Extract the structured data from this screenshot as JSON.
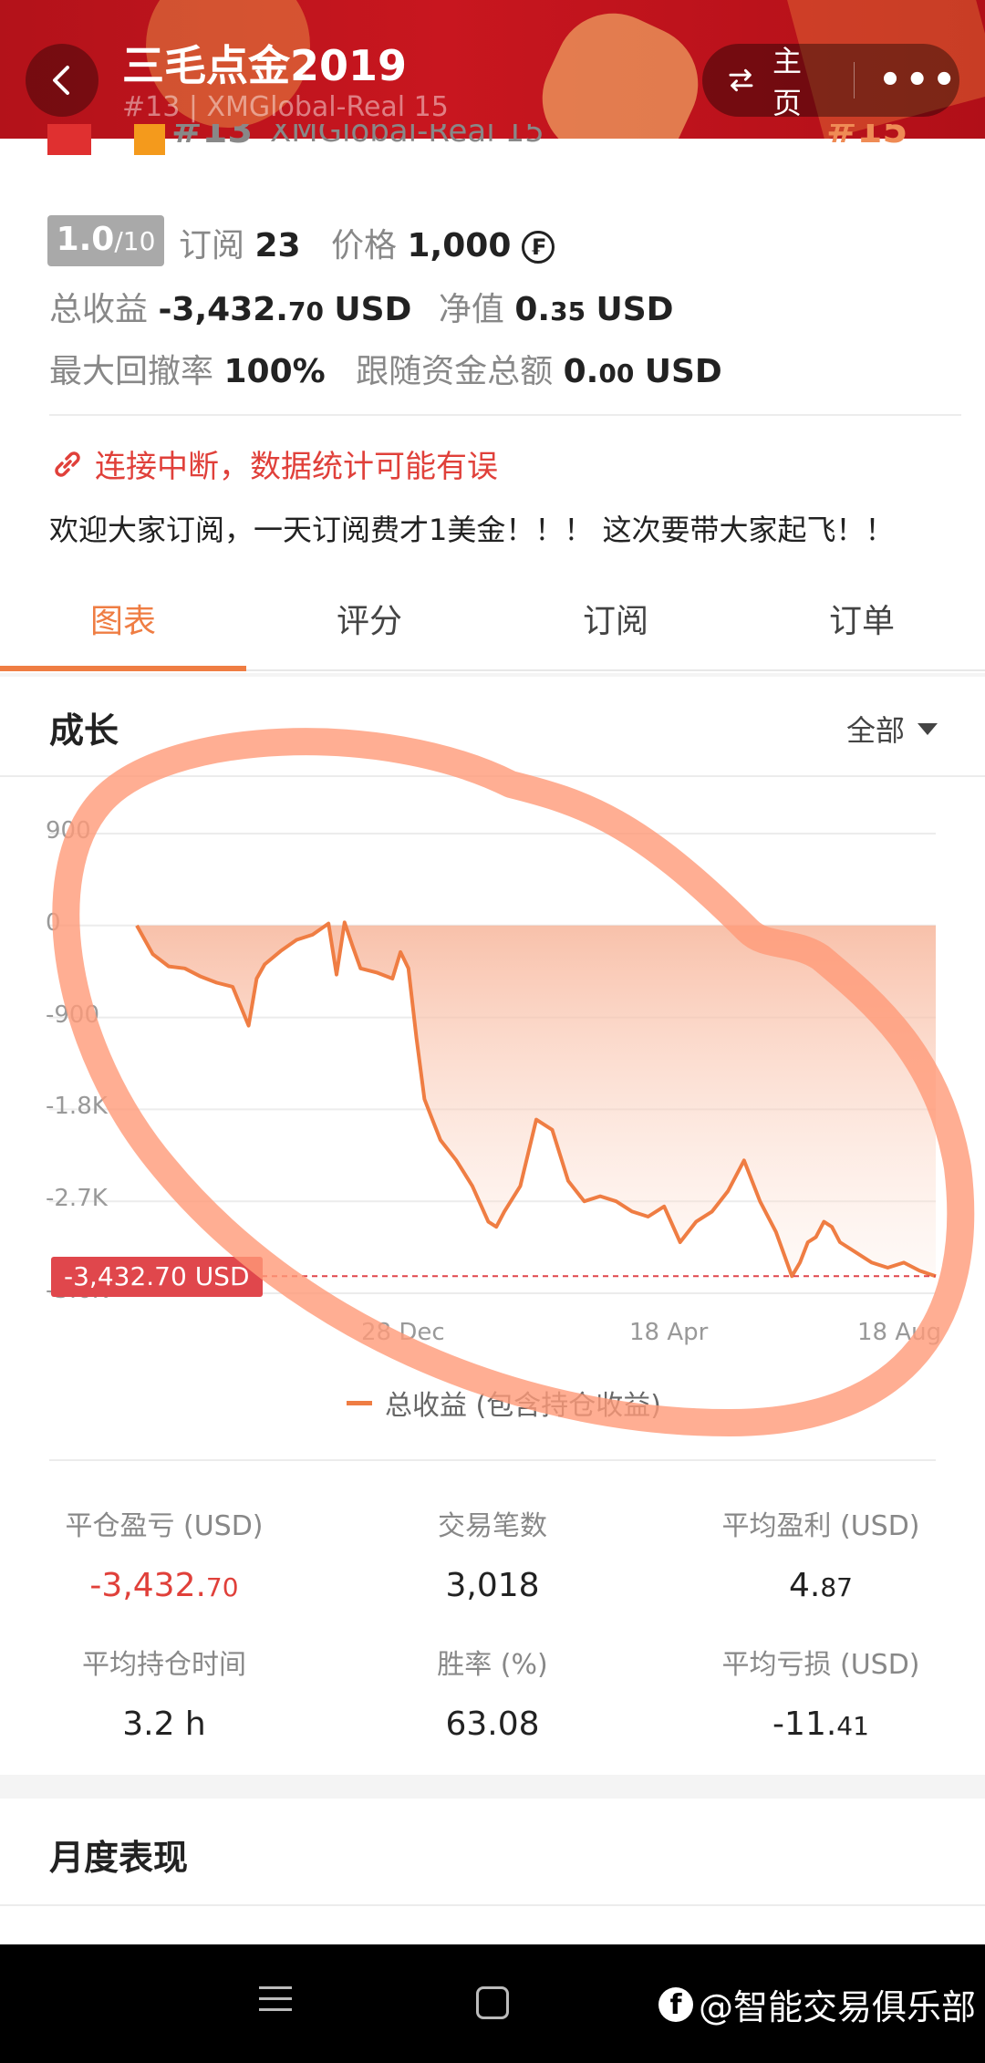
{
  "header": {
    "title": "三毛点金2019",
    "subtitle": "#13 | XMGlobal-Real 15",
    "home_label": "主页",
    "more_label": "•••"
  },
  "strip": {
    "rank": "#13",
    "account": "XMGlobal-Real 15",
    "rank_right": "#15"
  },
  "stats": {
    "score_main": "1.0",
    "score_max": "/10",
    "subscribe_label": "订阅",
    "subscribe_value": "23",
    "price_label": "价格",
    "price_value": "1,000",
    "price_icon": "₣",
    "total_profit_label": "总收益",
    "total_profit_main": "-3,432.",
    "total_profit_dec": "70",
    "total_profit_unit": "USD",
    "nav_label": "净值",
    "nav_main": "0.",
    "nav_dec": "35",
    "nav_unit": "USD",
    "drawdown_label": "最大回撤率",
    "drawdown_value": "100%",
    "follow_label": "跟随资金总额",
    "follow_main": "0.",
    "follow_dec": "00",
    "follow_unit": "USD"
  },
  "warning": "连接中断，数据统计可能有误",
  "description": "欢迎大家订阅，一天订阅费才1美金！！！ 这次要带大家起飞！！",
  "tabs": [
    "图表",
    "评分",
    "订阅",
    "订单"
  ],
  "growth": {
    "title": "成长",
    "filter": "全部"
  },
  "chart_data": {
    "type": "area",
    "title": "成长",
    "y_ticks": [
      "900",
      "0",
      "-900",
      "-1.8K",
      "-2.7K",
      "-3.6K"
    ],
    "x_ticks": [
      "28 Dec",
      "18 Apr",
      "18 Aug"
    ],
    "ylim": [
      -3600,
      900
    ],
    "series": [
      {
        "name": "总收益 (包含持仓收益)",
        "color": "#ef7d43",
        "x": [
          0,
          2,
          4,
          6,
          8,
          10,
          12,
          14,
          15,
          16,
          18,
          20,
          22,
          24,
          25,
          26,
          27,
          28,
          30,
          32,
          33,
          34,
          35,
          36,
          37,
          38,
          40,
          42,
          44,
          45,
          46,
          48,
          50,
          52,
          54,
          56,
          58,
          60,
          62,
          64,
          66,
          68,
          70,
          72,
          74,
          76,
          78,
          80,
          82,
          83,
          84,
          85,
          86,
          87,
          88,
          90,
          92,
          94,
          96,
          98,
          100
        ],
        "values": [
          0,
          -280,
          -400,
          -420,
          -500,
          -560,
          -600,
          -980,
          -520,
          -380,
          -250,
          -140,
          -90,
          20,
          -480,
          30,
          -200,
          -420,
          -460,
          -520,
          -260,
          -420,
          -1100,
          -1700,
          -1900,
          -2100,
          -2300,
          -2550,
          -2900,
          -2950,
          -2800,
          -2550,
          -1900,
          -2000,
          -2500,
          -2700,
          -2650,
          -2700,
          -2800,
          -2850,
          -2750,
          -3100,
          -2900,
          -2800,
          -2600,
          -2300,
          -2700,
          -3000,
          -3432.7,
          -3300,
          -3100,
          -3050,
          -2900,
          -2950,
          -3100,
          -3200,
          -3300,
          -3350,
          -3300,
          -3380,
          -3432.7
        ]
      }
    ],
    "current_value_label": "-3,432.70 USD",
    "legend": "总收益 (包含持仓收益)",
    "grid": true,
    "legend_position": "bottom-center"
  },
  "summary": [
    {
      "label": "平仓盈亏 (USD)",
      "main": "-3,432.",
      "dec": "70",
      "red": true
    },
    {
      "label": "交易笔数",
      "main": "3,018",
      "dec": "",
      "red": false
    },
    {
      "label": "平均盈利 (USD)",
      "main": "4.",
      "dec": "87",
      "red": false
    },
    {
      "label": "平均持仓时间",
      "main": "3.2 h",
      "dec": "",
      "red": false
    },
    {
      "label": "胜率 (%)",
      "main": "63.08",
      "dec": "",
      "red": false
    },
    {
      "label": "平均亏损 (USD)",
      "main": "-11.",
      "dec": "41",
      "red": false
    }
  ],
  "monthly": {
    "title": "月度表现"
  },
  "watermark": "@智能交易俱乐部",
  "watermark_icon": "f"
}
